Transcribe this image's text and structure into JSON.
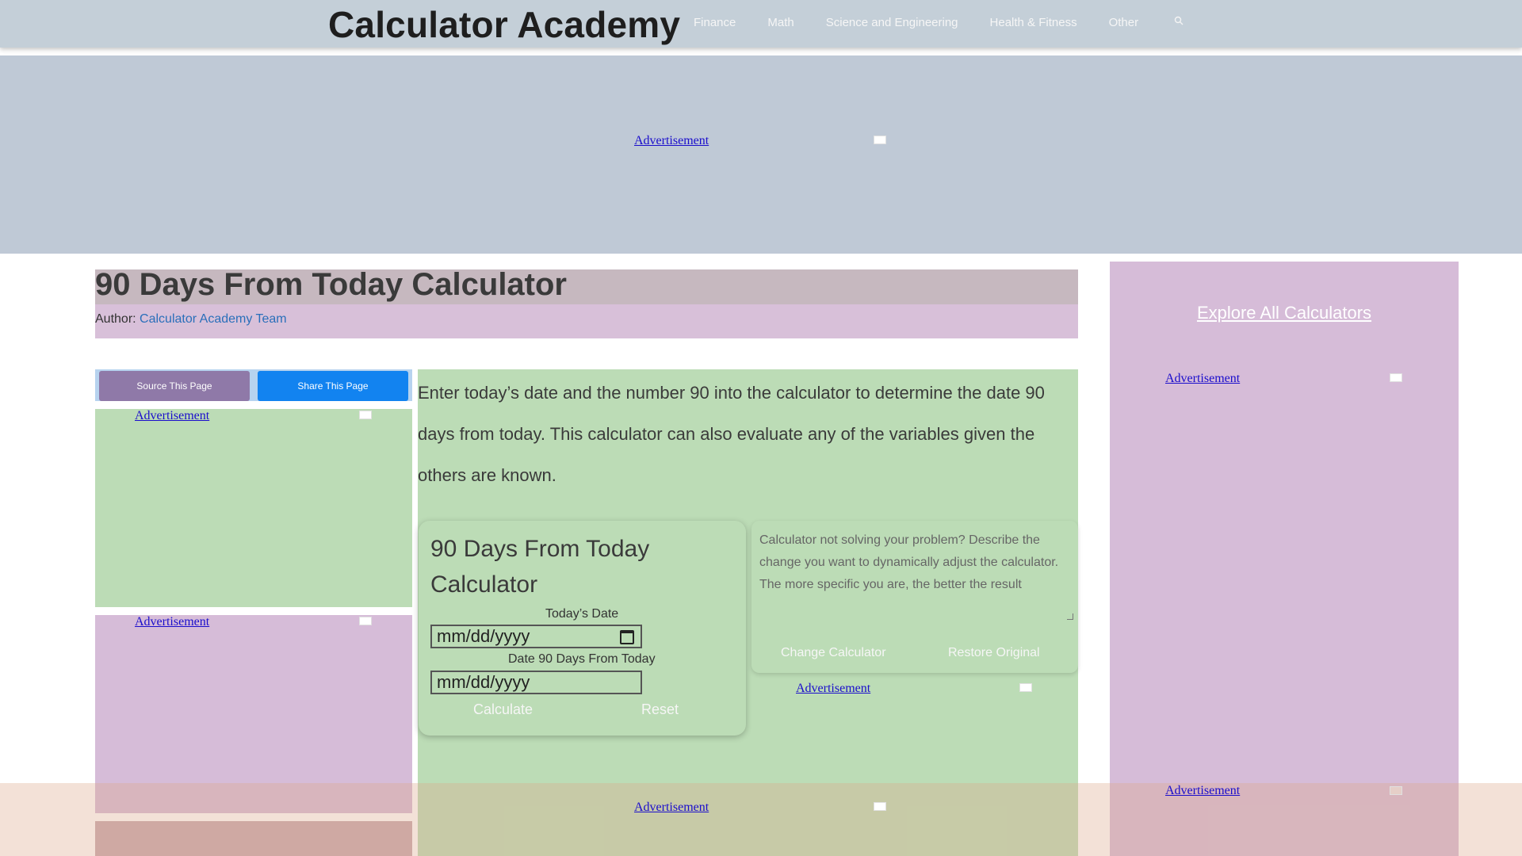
{
  "header": {
    "brand": "Calculator Academy",
    "nav": [
      "Finance",
      "Math",
      "Science and Engineering",
      "Health & Fitness",
      "Other"
    ],
    "search_icon": "search-icon"
  },
  "ads": {
    "label": "Advertisement"
  },
  "page": {
    "title": "90 Days From Today Calculator",
    "author_prefix": "Author:",
    "author_name": "Calculator Academy Team"
  },
  "actions": {
    "source": "Source This Page",
    "share": "Share This Page"
  },
  "intro": "Enter today’s date and the number 90 into the calculator to determine the date 90 days from today. This calculator can also evaluate any of the variables given the others are known.",
  "calculator": {
    "title": "90 Days From Today Calculator",
    "fields": [
      {
        "label": "Today’s Date",
        "value": "mm/dd/yyyy"
      },
      {
        "label": "Date 90 Days From Today",
        "value": "mm/dd/yyyy"
      }
    ],
    "calculate": "Calculate",
    "reset": "Reset"
  },
  "adjust": {
    "placeholder": "Calculator not solving your problem? Describe the change you want to dynamically adjust the calculator. The more specific you are, the better the result",
    "change": "Change Calculator",
    "restore": "Restore Original"
  },
  "sidebar": {
    "explore": "Explore All Calculators"
  }
}
